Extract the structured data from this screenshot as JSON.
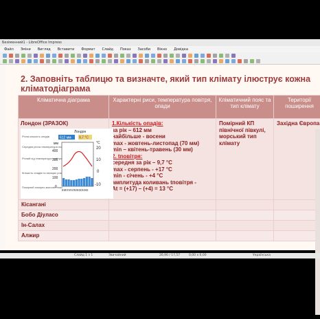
{
  "window": {
    "title": "Безіменний1 - LibreOffice Impress"
  },
  "menu": [
    "Файл",
    "Зміни",
    "Вигляд",
    "Вставити",
    "Формат",
    "Слайд",
    "Показ",
    "Засоби",
    "Вікно",
    "Довідка"
  ],
  "slide": {
    "title": "2. Заповніть таблицю та визначте, який тип клімату ілюструє кожна кліматодіаграма",
    "headers": [
      "Кліматична діаграма",
      "Характерні риси, температура повітря, опади",
      "Кліматичний пояс та тип клімату",
      "Території поширення"
    ],
    "example": {
      "city": "Лондон (ЗРАЗОК)",
      "desc": [
        {
          "text": "1.Кількість опадів:",
          "hdr": true
        },
        {
          "text": "за рік – 612 мм",
          "hdr": false
        },
        {
          "text": "найбільше - восени",
          "hdr": false
        },
        {
          "text": "max - жовтень-листопад (70 мм)",
          "hdr": false
        },
        {
          "text": "min – квітень-травень (30 мм)",
          "hdr": false
        },
        {
          "text": "2. tповітря:",
          "hdr": true
        },
        {
          "text": "середня за рік – 9,7 °С",
          "hdr": false
        },
        {
          "text": "max - серпень  - +17 °С",
          "hdr": false
        },
        {
          "text": "min - січень - +4 °С",
          "hdr": false
        },
        {
          "text": "амплитуда коливань tповітря -",
          "hdr": false
        },
        {
          "text": "At = (+17) – (+4) = 13 °С",
          "hdr": false
        }
      ],
      "belt": "Помірний КП північної півкулі, морський тип клімату",
      "territory": "Західна Європа",
      "diagram": {
        "city": "Лондон",
        "annual_precip": "612 мм",
        "annual_temp": "9,7 °С",
        "legend": [
          "Річна кількість опадів",
          "Середня річна температура повітря",
          "Річний хід температури повітря",
          "Кількість опадів по місяцях року",
          "Помірний помірно-вологий пояс"
        ],
        "mm_ticks": [
          "400",
          "300",
          "200",
          "100",
          "0"
        ],
        "temp_ticks": [
          "°С",
          "20",
          "10",
          "0",
          "-10"
        ],
        "months": "ІІІІІVVІVІІVІІІХХІХІІ",
        "mm_label": "мм"
      }
    },
    "rows": [
      "Кісангані",
      "Бобо Діуласо",
      "Ін-Салах",
      "Алжир"
    ]
  },
  "status": {
    "slide": "Слайд 1 з 1",
    "layout": "Звичайний",
    "coords": "26,90 / 17,57",
    "size": "0,00 x 0,00",
    "lang": "Українська"
  }
}
